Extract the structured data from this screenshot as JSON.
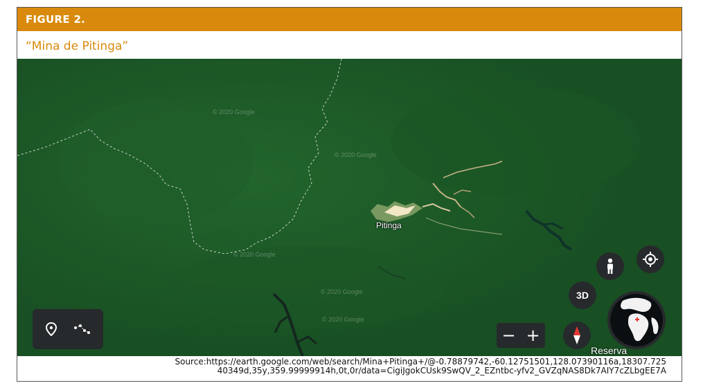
{
  "figure": {
    "label": "FIGURE 2.",
    "title": "“Mina de Pitinga”",
    "accent_color": "#d98a0c"
  },
  "map": {
    "place_label": "Pitinga",
    "place_label_secondary": "Reserva",
    "watermarks": [
      "© 2020 Google",
      "© 2020 Google",
      "© 2020 Google",
      "© 2020 Google",
      "© 2020 Google"
    ],
    "colors": {
      "forest": "#1c5a27",
      "river": "#0f3329",
      "mine": "#e8d8b0"
    }
  },
  "controls": {
    "place_marker_icon": "map-pin-icon",
    "path_icon": "line-path-icon",
    "zoom_out_label": "−",
    "zoom_in_label": "+",
    "three_d_label": "3D",
    "pegman_icon": "pegman-icon",
    "my_location_icon": "my-location-icon",
    "compass_icon": "compass-icon",
    "globe_icon": "globe-icon"
  },
  "source": {
    "line1": "Source:https://earth.google.com/web/search/Mina+Pitinga+/@-0.78879742,-60.12751501,128.07390116a,18307.725",
    "line2": "40349d,35y,359.99999914h,0t,0r/data=CigiJgokCUsk9SwQV_2_EZntbc-yfv2_GVZqNAS8Dk7AIY7cZLbgEE7A"
  }
}
